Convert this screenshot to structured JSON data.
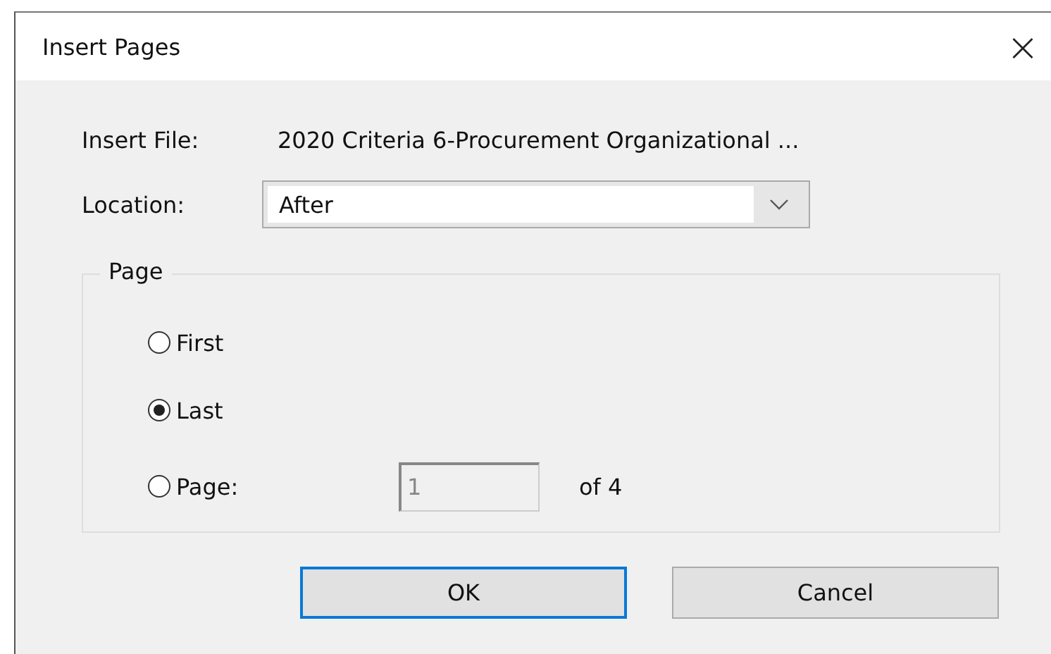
{
  "window": {
    "title": "Insert Pages",
    "close": "×"
  },
  "insert_file": {
    "label": "Insert File:",
    "value": "2020 Criteria 6-Procurement Organizational ..."
  },
  "location": {
    "label": "Location:",
    "value": "After"
  },
  "page_group": {
    "title": "Page",
    "options": [
      {
        "label": "First",
        "selected": false
      },
      {
        "label": "Last",
        "selected": true
      },
      {
        "label": "Page:",
        "selected": false
      }
    ],
    "page_field": {
      "value": "1",
      "disabled": true
    },
    "of_text": "of 4"
  },
  "buttons": [
    {
      "label": "OK",
      "focused": true
    },
    {
      "label": "Cancel",
      "focused": false
    }
  ]
}
